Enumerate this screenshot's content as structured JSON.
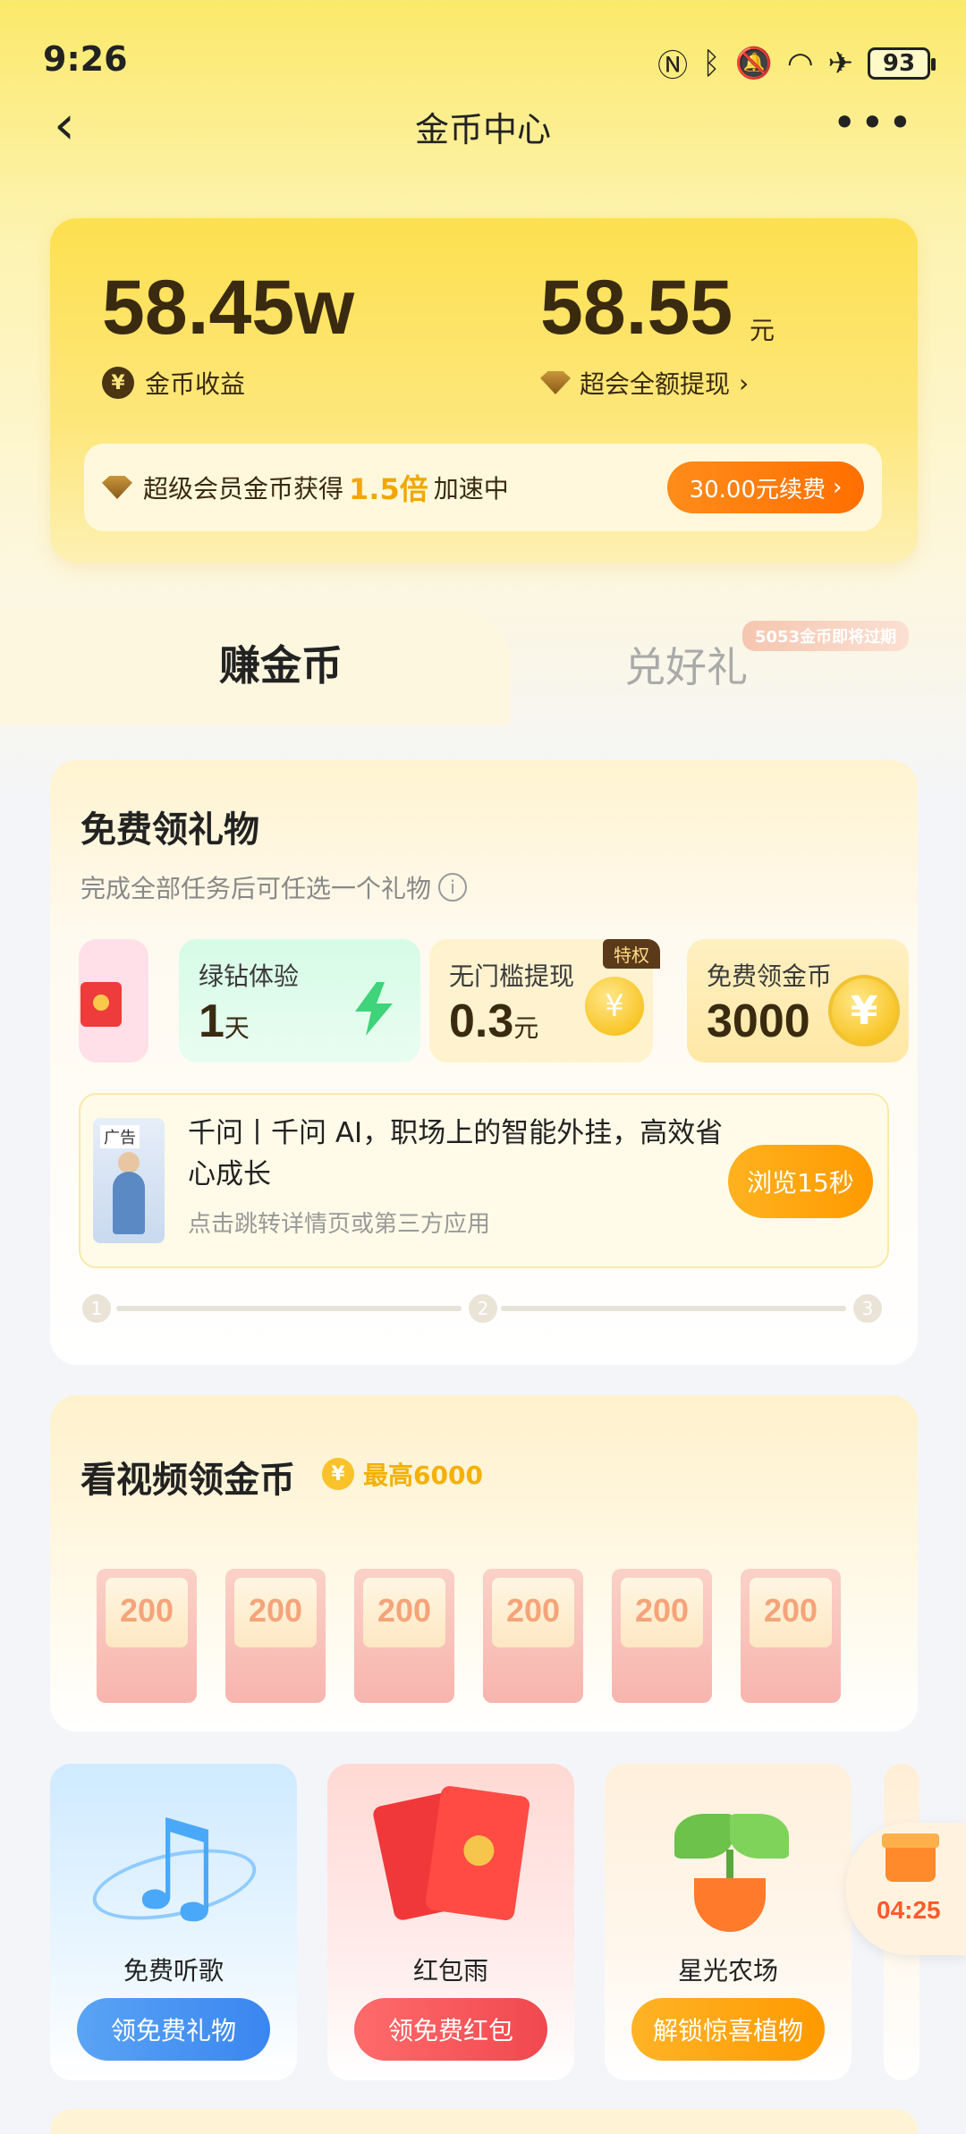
{
  "status_bar": {
    "time": "9:26",
    "battery": "93"
  },
  "nav": {
    "title": "金币中心"
  },
  "balance": {
    "coins": "58.45w",
    "coins_label": "金币收益",
    "cash": "58.55",
    "cash_unit": "元",
    "cash_label": "超会全额提现",
    "vip_text_before": "超级会员金币获得",
    "vip_multiplier": "1.5倍",
    "vip_text_after": "加速中",
    "renew_button": "30.00元续费"
  },
  "tabs": {
    "earn": "赚金币",
    "redeem": "兑好礼",
    "expire_badge": "5053金币即将过期"
  },
  "gift_section": {
    "title": "免费领礼物",
    "subtitle": "完成全部任务后可任选一个礼物",
    "rewards": [
      {
        "label": "绿钻体验",
        "value": "1",
        "unit": "天"
      },
      {
        "label": "无门槛提现",
        "value": "0.3",
        "unit": "元",
        "badge": "特权"
      },
      {
        "label": "免费领金币",
        "value": "3000"
      }
    ],
    "ad": {
      "tag": "广告",
      "title": "千问丨千问 AI，职场上的智能外挂，高效省心成长",
      "subtitle": "点击跳转详情页或第三方应用",
      "button": "浏览15秒"
    },
    "steps": [
      "1",
      "2",
      "3"
    ]
  },
  "video_section": {
    "title": "看视频领金币",
    "max_badge": "最高6000",
    "cards": [
      "200",
      "200",
      "200",
      "200",
      "200",
      "200"
    ]
  },
  "activities": [
    {
      "label": "免费听歌",
      "button": "领免费礼物"
    },
    {
      "label": "红包雨",
      "button": "领免费红包"
    },
    {
      "label": "星光农场",
      "button": "解锁惊喜植物"
    }
  ],
  "float_timer": "04:25",
  "colors": {
    "accent_orange": "#ff7a00",
    "gold": "#f5b000",
    "balance_text": "#3a2a10"
  }
}
